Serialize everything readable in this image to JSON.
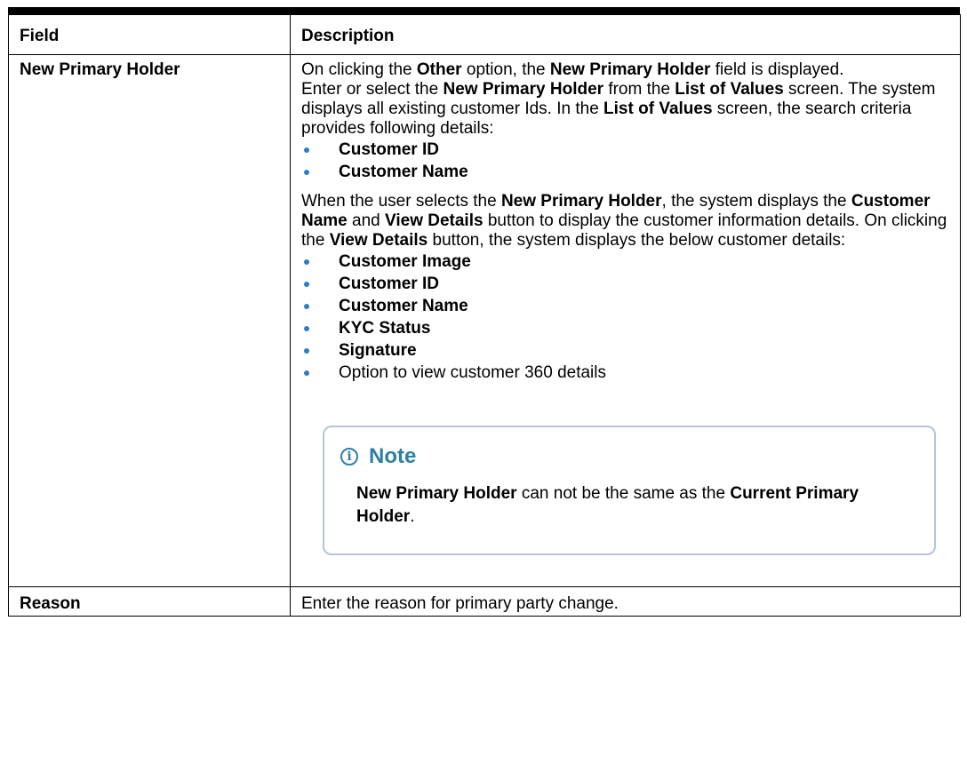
{
  "table": {
    "headers": [
      "Field",
      "Description"
    ],
    "row1": {
      "field": "New Primary Holder",
      "p1": {
        "t1": "On clicking the ",
        "b1": "Other",
        "t2": " option, the ",
        "b2": "New Primary Holder",
        "t3": " field is displayed."
      },
      "p2": {
        "t1": "Enter or select the ",
        "b1": "New Primary Holder",
        "t2": " from the ",
        "b2": "List of Values",
        "t3": " screen. The system displays all existing customer Ids. In the ",
        "b3": "List of Values",
        "t4": " screen, the search criteria provides following details:"
      },
      "list1": [
        "Customer ID",
        "Customer Name"
      ],
      "p3": {
        "t1": "When the user selects the ",
        "b1": "New Primary Holder",
        "t2": ", the system displays the ",
        "b2": "Customer Name",
        "t3": " and ",
        "b3": "View Details",
        "t4": " button to display the customer information details. On clicking the ",
        "b4": "View Details",
        "t5": " button, the system displays the below customer details:"
      },
      "list2": [
        "Customer Image",
        "Customer ID",
        "Customer Name",
        "KYC Status",
        "Signature"
      ],
      "list2_plain": "Option to view customer 360 details",
      "note": {
        "icon": "i",
        "title": "Note",
        "b1": "New Primary Holder",
        "t1": " can not be the same as the ",
        "b2": "Current Primary Holder",
        "t2": "."
      }
    },
    "row2": {
      "field": "Reason",
      "description": "Enter the reason for primary party change."
    }
  },
  "colors": {
    "bullet": "#2d7cc7",
    "note_accent": "#2e7fa6",
    "note_border": "#b7c4d3"
  }
}
